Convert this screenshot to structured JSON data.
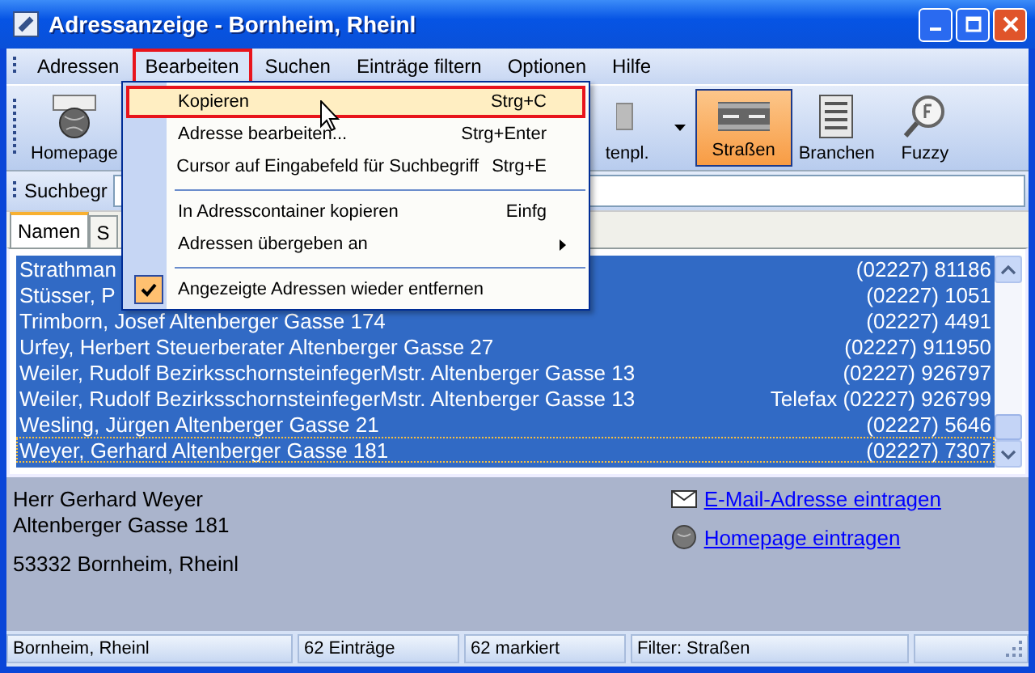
{
  "window": {
    "title": "Adressanzeige - Bornheim, Rheinl"
  },
  "menu_bar": [
    {
      "label": "Adressen",
      "selected": false
    },
    {
      "label": "Bearbeiten",
      "selected": true
    },
    {
      "label": "Suchen",
      "selected": false
    },
    {
      "label": "Einträge filtern",
      "selected": false
    },
    {
      "label": "Optionen",
      "selected": false
    },
    {
      "label": "Hilfe",
      "selected": false
    }
  ],
  "toolbar": [
    {
      "kind": "homepage",
      "label": "Homepage",
      "selected": false
    },
    {
      "kind": "template",
      "label": "tenpl.",
      "selected": false
    },
    {
      "kind": "streets",
      "label": "Straßen",
      "selected": true
    },
    {
      "kind": "branches",
      "label": "Branchen",
      "selected": false
    },
    {
      "kind": "fuzzy",
      "label": "Fuzzy",
      "selected": false
    }
  ],
  "search": {
    "label": "Suchbegr"
  },
  "tabs": [
    {
      "label": "Namen",
      "selected": true
    },
    {
      "label": "S",
      "selected": false
    }
  ],
  "rows": [
    {
      "name": "Strathman",
      "phone": "(02227) 81186",
      "selected": true,
      "focused": false
    },
    {
      "name": "Stüsser, P",
      "phone": "(02227) 1051",
      "selected": true,
      "focused": false
    },
    {
      "name": "Trimborn, Josef Altenberger Gasse 174",
      "phone": "(02227) 4491",
      "selected": true,
      "focused": false
    },
    {
      "name": "Urfey, Herbert Steuerberater Altenberger Gasse 27",
      "phone": "(02227) 911950",
      "selected": true,
      "focused": false
    },
    {
      "name": "Weiler, Rudolf BezirksschornsteinfegerMstr. Altenberger Gasse 13",
      "phone": "(02227) 926797",
      "selected": true,
      "focused": false
    },
    {
      "name": "Weiler, Rudolf BezirksschornsteinfegerMstr. Altenberger Gasse 13",
      "phone": "Telefax (02227) 926799",
      "selected": true,
      "focused": false
    },
    {
      "name": "Wesling, Jürgen Altenberger Gasse 21",
      "phone": "(02227) 5646",
      "selected": true,
      "focused": false
    },
    {
      "name": "Weyer, Gerhard Altenberger Gasse 181",
      "phone": "(02227) 7307",
      "selected": true,
      "focused": true
    }
  ],
  "detail": {
    "lines": [
      "Herr Gerhard Weyer",
      "Altenberger Gasse 181"
    ],
    "city": "53332 Bornheim, Rheinl",
    "links": [
      {
        "kind": "email",
        "label": "E-Mail-Adresse eintragen"
      },
      {
        "kind": "web",
        "label": "Homepage eintragen"
      }
    ]
  },
  "status_bar": [
    "Bornheim, Rheinl",
    "62 Einträge",
    "62 markiert",
    "Filter: Straßen"
  ],
  "dropdown": [
    {
      "kind": "item",
      "label": "Kopieren",
      "shortcut": "Strg+C",
      "highlighted": true,
      "checked": false
    },
    {
      "kind": "item",
      "label": "Adresse bearbeiten...",
      "shortcut": "Strg+Enter",
      "highlighted": false,
      "checked": false
    },
    {
      "kind": "item",
      "label": "Cursor auf Eingabefeld für Suchbegriff",
      "shortcut": "Strg+E",
      "highlighted": false,
      "checked": false
    },
    {
      "kind": "separator"
    },
    {
      "kind": "item",
      "label": "In Adresscontainer kopieren",
      "shortcut": "Einfg",
      "highlighted": false,
      "checked": false
    },
    {
      "kind": "submenu",
      "label": "Adressen übergeben an",
      "highlighted": false,
      "checked": false
    },
    {
      "kind": "separator"
    },
    {
      "kind": "item",
      "label": "Angezeigte Adressen wieder entfernen",
      "highlighted": false,
      "checked": true
    }
  ]
}
